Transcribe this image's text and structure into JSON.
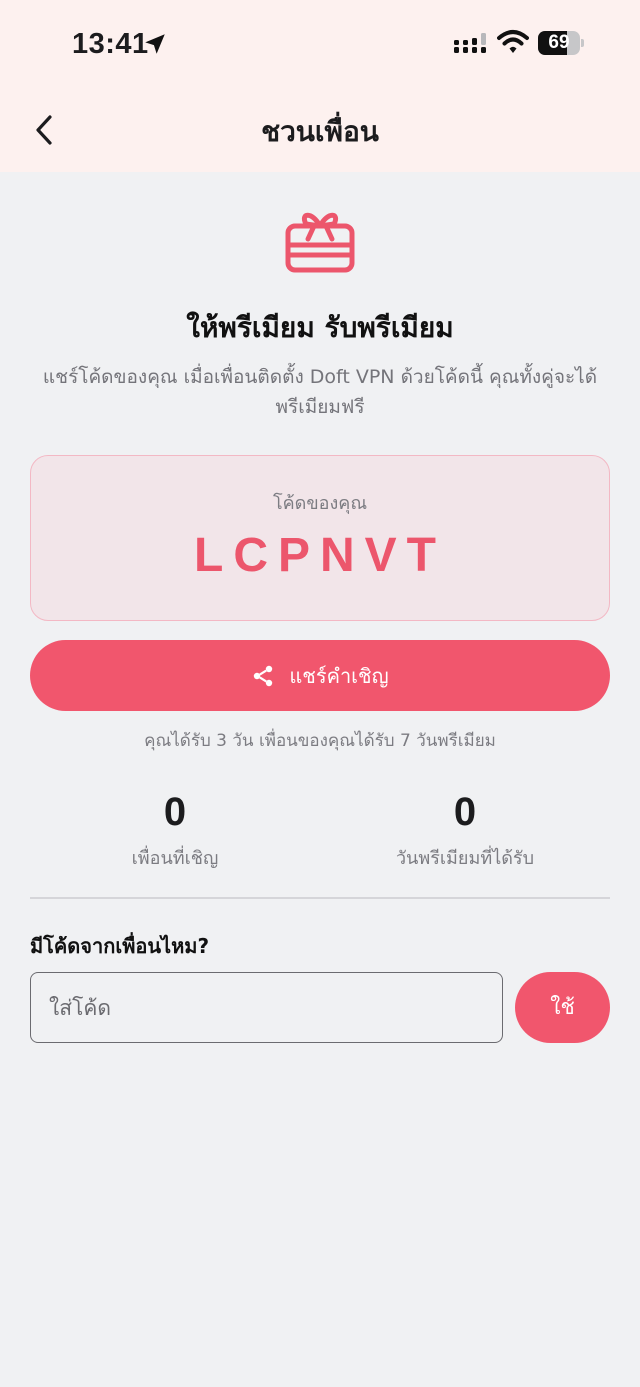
{
  "status_bar": {
    "time": "13:41",
    "battery_level": "69",
    "battery_fraction": 0.69,
    "location_icon": "location-arrow-icon",
    "signal_icon": "cellular-signal-icon",
    "wifi_icon": "wifi-icon"
  },
  "header": {
    "title": "ชวนเพื่อน",
    "back_icon": "chevron-left-icon"
  },
  "hero": {
    "icon": "gift-icon",
    "headline": "ให้พรีเมียม รับพรีเมียม",
    "description": "แชร์โค้ดของคุณ เมื่อเพื่อนติดตั้ง Doft VPN ด้วยโค้ดนี้ คุณทั้งคู่จะได้พรีเมียมฟรี"
  },
  "referral": {
    "label": "โค้ดของคุณ",
    "code": "LCPNVT"
  },
  "share": {
    "label": "แชร์คำเชิญ",
    "icon": "share-icon"
  },
  "reward_note": "คุณได้รับ 3 วัน เพื่อนของคุณได้รับ 7 วันพรีเมียม",
  "stats": [
    {
      "value": "0",
      "label": "เพื่อนที่เชิญ"
    },
    {
      "value": "0",
      "label": "วันพรีเมียมที่ได้รับ"
    }
  ],
  "redeem": {
    "title": "มีโค้ดจากเพื่อนไหม?",
    "placeholder": "ใส่โค้ด",
    "value": "",
    "button_label": "ใช้"
  },
  "colors": {
    "accent": "#f1566d",
    "header_bg": "#fdf1ef",
    "page_bg": "#f0f1f3",
    "code_card_bg": "#f2e5e9",
    "code_card_border": "#f3b8c4"
  }
}
